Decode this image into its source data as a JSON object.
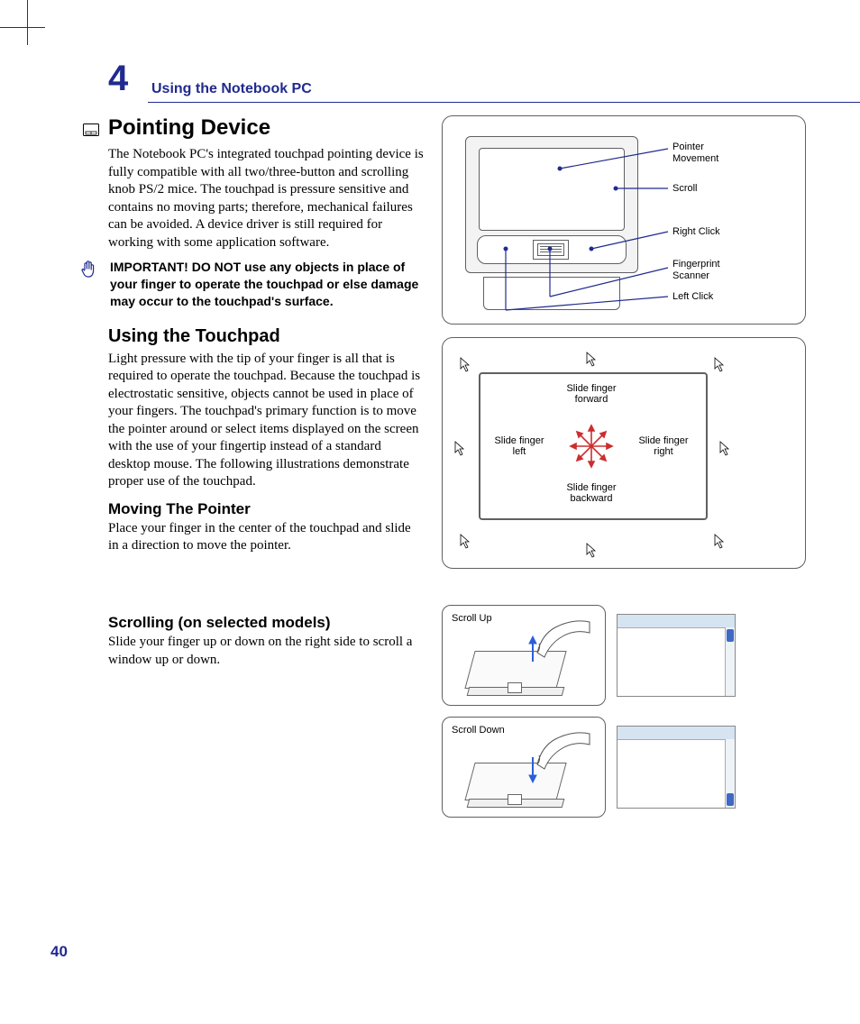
{
  "chapter": {
    "number": "4",
    "title": "Using the Notebook PC"
  },
  "section": {
    "title": "Pointing Device",
    "intro": "The Notebook PC's integrated touchpad pointing device is fully compatible with all two/three-button and scrolling knob PS/2 mice. The touchpad is pressure sensitive and contains no moving parts; therefore, mechanical failures can be avoided. A device driver is still required for working with some application software.",
    "important": "IMPORTANT! DO NOT use any objects in place of your finger to operate the touchpad or else damage may occur to the touchpad's surface."
  },
  "touchpad": {
    "heading": "Using the Touchpad",
    "text": "Light pressure with the tip of your finger is all that is required to operate the touchpad. Because the touchpad is electrostatic sensitive, objects cannot be used in place of your fingers. The touchpad's primary function is to move the pointer around or select items displayed on the screen with the use of your fingertip instead of a standard desktop mouse. The following illustrations demonstrate proper use of the touchpad.",
    "moving_heading": "Moving The Pointer",
    "moving_text": "Place your finger in the center of the touchpad and slide in a direction to move the pointer."
  },
  "scrolling": {
    "heading": "Scrolling (on selected models)",
    "text": "Slide your finger up or down on the right side to scroll a window up or down.",
    "up_label": "Scroll Up",
    "down_label": "Scroll Down"
  },
  "diagram1_labels": {
    "pointer": "Pointer Movement",
    "scroll": "Scroll",
    "right_click": "Right Click",
    "fingerprint": "Fingerprint Scanner",
    "left_click": "Left Click"
  },
  "diagram2_labels": {
    "forward": "Slide finger forward",
    "backward": "Slide finger backward",
    "left": "Slide finger left",
    "right": "Slide finger right"
  },
  "page_number": "40"
}
